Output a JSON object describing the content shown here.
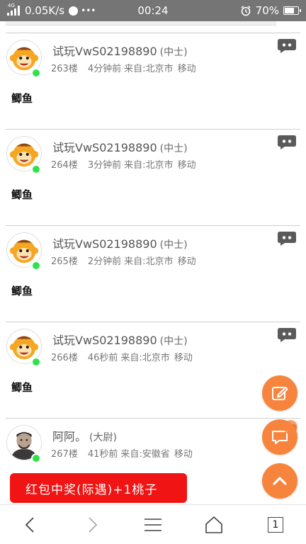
{
  "status_bar": {
    "network_type": "4G",
    "speed": "0.05K/s",
    "notification_dots": "•••",
    "time": "00:24",
    "battery": "70%",
    "battery_level": 0.7
  },
  "posts": [
    {
      "username": "试玩VwS02198890",
      "rank": "(中士)",
      "floor": "263楼",
      "time_ago": "4分钟前",
      "source": "来自:北京市 移动",
      "content": "鲫鱼",
      "avatar": "monkey"
    },
    {
      "username": "试玩VwS02198890",
      "rank": "(中士)",
      "floor": "264楼",
      "time_ago": "3分钟前",
      "source": "来自:北京市 移动",
      "content": "鲫鱼",
      "avatar": "monkey"
    },
    {
      "username": "试玩VwS02198890",
      "rank": "(中士)",
      "floor": "265楼",
      "time_ago": "2分钟前",
      "source": "来自:北京市 移动",
      "content": "鲫鱼",
      "avatar": "monkey"
    },
    {
      "username": "试玩VwS02198890",
      "rank": "(中士)",
      "floor": "266楼",
      "time_ago": "46秒前",
      "source": "来自:北京市 移动",
      "content": "鲫鱼",
      "avatar": "monkey"
    },
    {
      "username": "阿阿。",
      "rank": "(大尉)",
      "floor": "267楼",
      "time_ago": "41秒前",
      "source": "来自:安徽省 移动",
      "content": "",
      "avatar": "person"
    }
  ],
  "fabs": {
    "edit": "edit-icon",
    "comment": "comment-icon",
    "scroll_top": "chevron-up-icon"
  },
  "banner": {
    "text": "红包中奖(际遇)+1桃子"
  },
  "bottom_nav": {
    "back": "chevron-left-icon",
    "forward": "chevron-right-icon",
    "menu": "menu-icon",
    "home": "home-icon",
    "tab_count": "1"
  },
  "colors": {
    "accent": "#f7843d",
    "online": "#2ee34a",
    "banner": "#f01414",
    "status_bar": "#757575"
  }
}
